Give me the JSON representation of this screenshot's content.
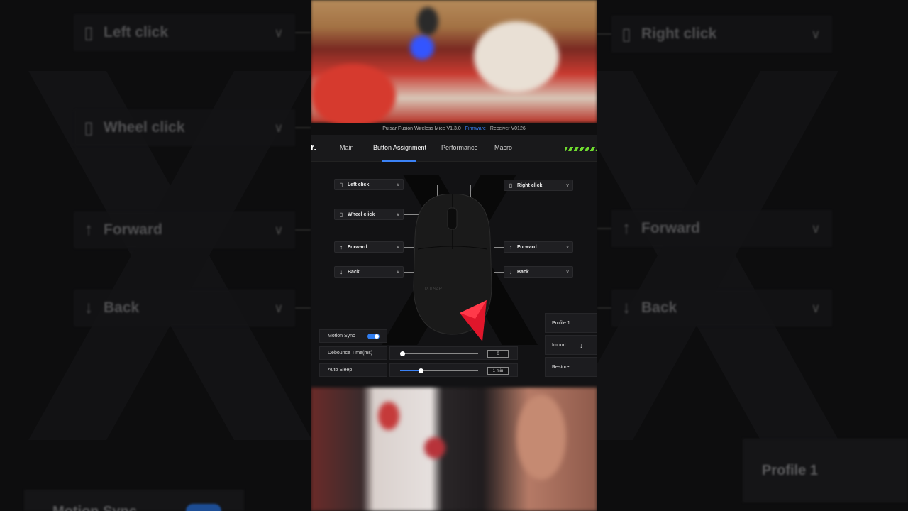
{
  "app": {
    "title": "Pulsar Fusion Wireless Mice V1.3.0",
    "firmware_label": "Firmware",
    "receiver": "Receiver V0126",
    "logo": "r."
  },
  "nav": {
    "tabs": [
      "Main",
      "Button Assignment",
      "Performance",
      "Macro"
    ],
    "active": "Button Assignment"
  },
  "buttons": {
    "left_click": "Left click",
    "right_click": "Right click",
    "wheel_click": "Wheel click",
    "forward_left": "Forward",
    "forward_right": "Forward",
    "back_left": "Back",
    "back_right": "Back"
  },
  "settings": {
    "motion_sync": {
      "label": "Motion Sync",
      "enabled": true
    },
    "debounce": {
      "label": "Debounce Time(ms)",
      "value": "0",
      "fraction": 0.0
    },
    "auto_sleep": {
      "label": "Auto Sleep",
      "value": "1 min",
      "fraction": 0.27
    }
  },
  "profile": {
    "name": "Profile 1",
    "import_label": "Import",
    "restore_label": "Restore"
  },
  "background": {
    "left_click": "Left click",
    "wheel_click": "Wheel click",
    "forward": "Forward",
    "back": "Back",
    "right_click": "Right click",
    "forward_r": "Forward",
    "back_r": "Back",
    "profile": "Profile 1",
    "motion_sync": "Motion Sync"
  },
  "colors": {
    "accent": "#3b82f6",
    "battery": "#6fdc2f",
    "arrow": "#e0162b"
  }
}
